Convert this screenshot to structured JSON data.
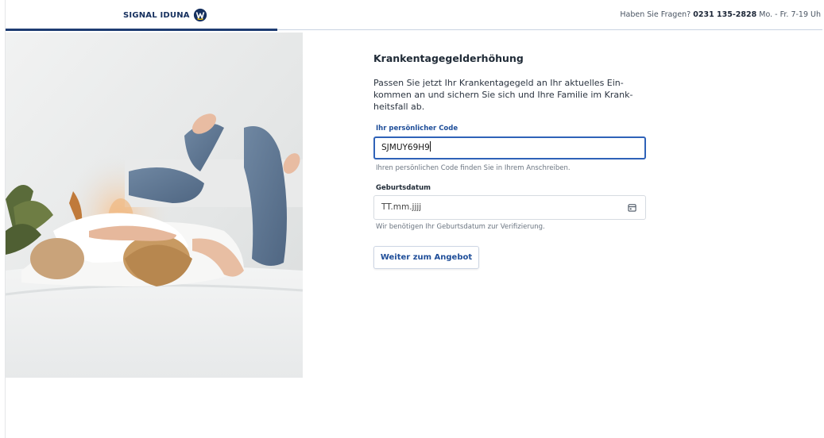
{
  "header": {
    "logo_text": "SIGNAL IDUNA",
    "contact_prefix": "Haben Sie Fragen?",
    "contact_phone": "0231 135-2828",
    "contact_hours": "Mo. - Fr. 7-19 Uh"
  },
  "form": {
    "title": "Krankentagegelderhöhung",
    "intro": "Passen Sie jetzt Ihr Krankentagegeld an Ihr aktuelles Ein­kommen an und sichern Sie sich und Ihre Familie im Krank­heitsfall ab.",
    "code_label": "Ihr persönlicher Code",
    "code_value": "SJMUY69H9",
    "code_hint": "Ihren persönlichen Code finden Sie in Ihrem Anschreiben.",
    "birth_label": "Geburtsdatum",
    "birth_placeholder": "TT.mm.jjjj",
    "birth_hint": "Wir benötigen Ihr Geburtsdatum zur Verifizierung.",
    "submit_label": "Weiter zum Angebot"
  },
  "colors": {
    "brand": "#16305e",
    "accent": "#2f62b8",
    "link": "#1f4e99"
  },
  "icons": {
    "logo": "signal-iduna-logo-icon",
    "calendar": "calendar-icon"
  }
}
